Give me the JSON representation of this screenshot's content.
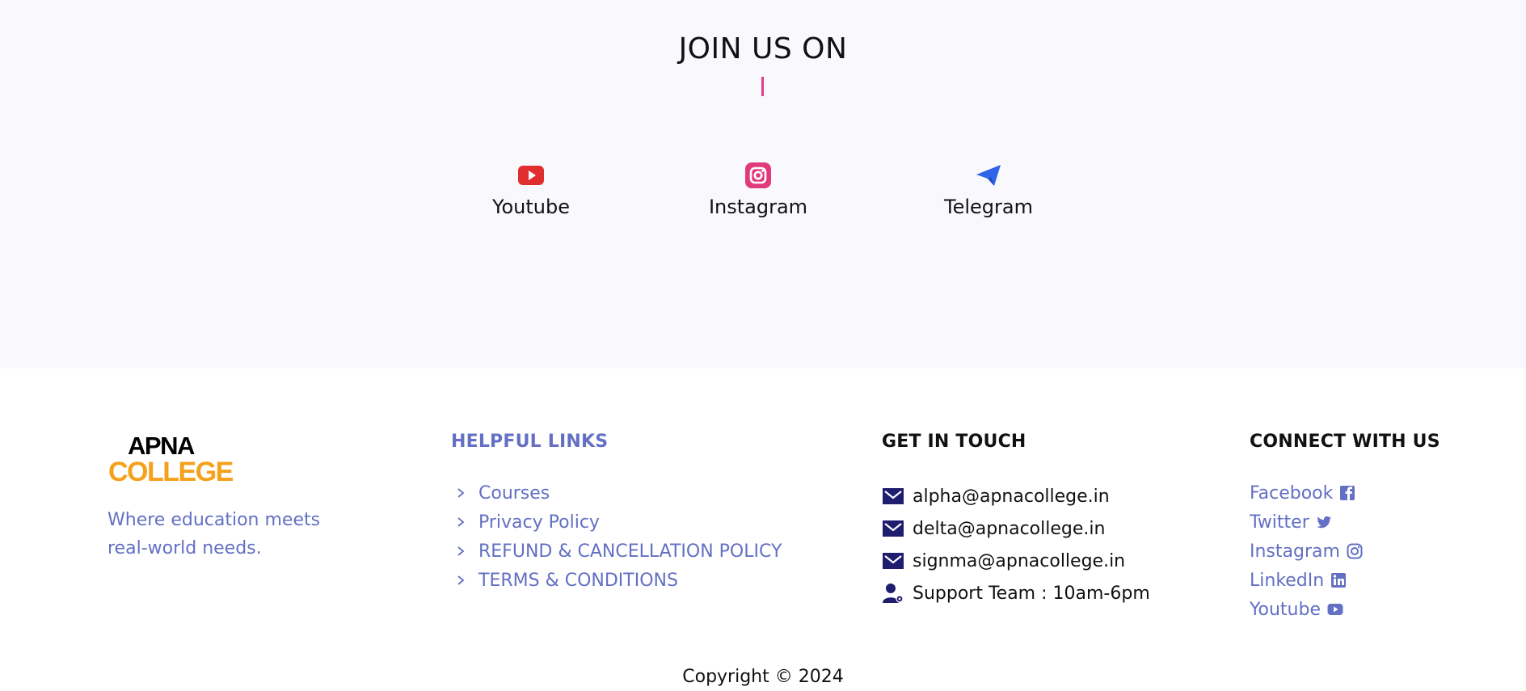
{
  "join": {
    "title": "JOIN US ON",
    "accent_color": "#e23c8c",
    "items": [
      {
        "label": "Youtube",
        "icon": "youtube-icon",
        "color": "#e02d2d"
      },
      {
        "label": "Instagram",
        "icon": "instagram-icon",
        "color": "#e03a7c"
      },
      {
        "label": "Telegram",
        "icon": "telegram-icon",
        "color": "#2f65e8"
      }
    ]
  },
  "footer": {
    "logo": {
      "line1": "APNA",
      "line2": "COLLEGE",
      "line2_color": "#f5a11b"
    },
    "tagline": "Where education meets real-world needs.",
    "helpful": {
      "title": "HELPFUL LINKS",
      "links": [
        "Courses",
        "Privacy Policy",
        "REFUND & CANCELLATION POLICY",
        "TERMS & CONDITIONS"
      ]
    },
    "touch": {
      "title": "GET IN TOUCH",
      "items": [
        {
          "text": "alpha@apnacollege.in",
          "icon": "mail-icon"
        },
        {
          "text": "delta@apnacollege.in",
          "icon": "mail-icon"
        },
        {
          "text": "signma@apnacollege.in",
          "icon": "mail-icon"
        },
        {
          "text": "Support Team : 10am-6pm",
          "icon": "support-user-icon"
        }
      ]
    },
    "connect": {
      "title": "CONNECT WITH US",
      "items": [
        {
          "label": "Facebook",
          "icon": "facebook-icon"
        },
        {
          "label": "Twitter",
          "icon": "twitter-icon"
        },
        {
          "label": "Instagram",
          "icon": "instagram-icon"
        },
        {
          "label": "LinkedIn",
          "icon": "linkedin-icon"
        },
        {
          "label": "Youtube",
          "icon": "youtube-icon"
        }
      ]
    },
    "copyright": "Copyright © 2024",
    "link_color": "#6370c3",
    "icon_color": "#1f1d6e"
  }
}
